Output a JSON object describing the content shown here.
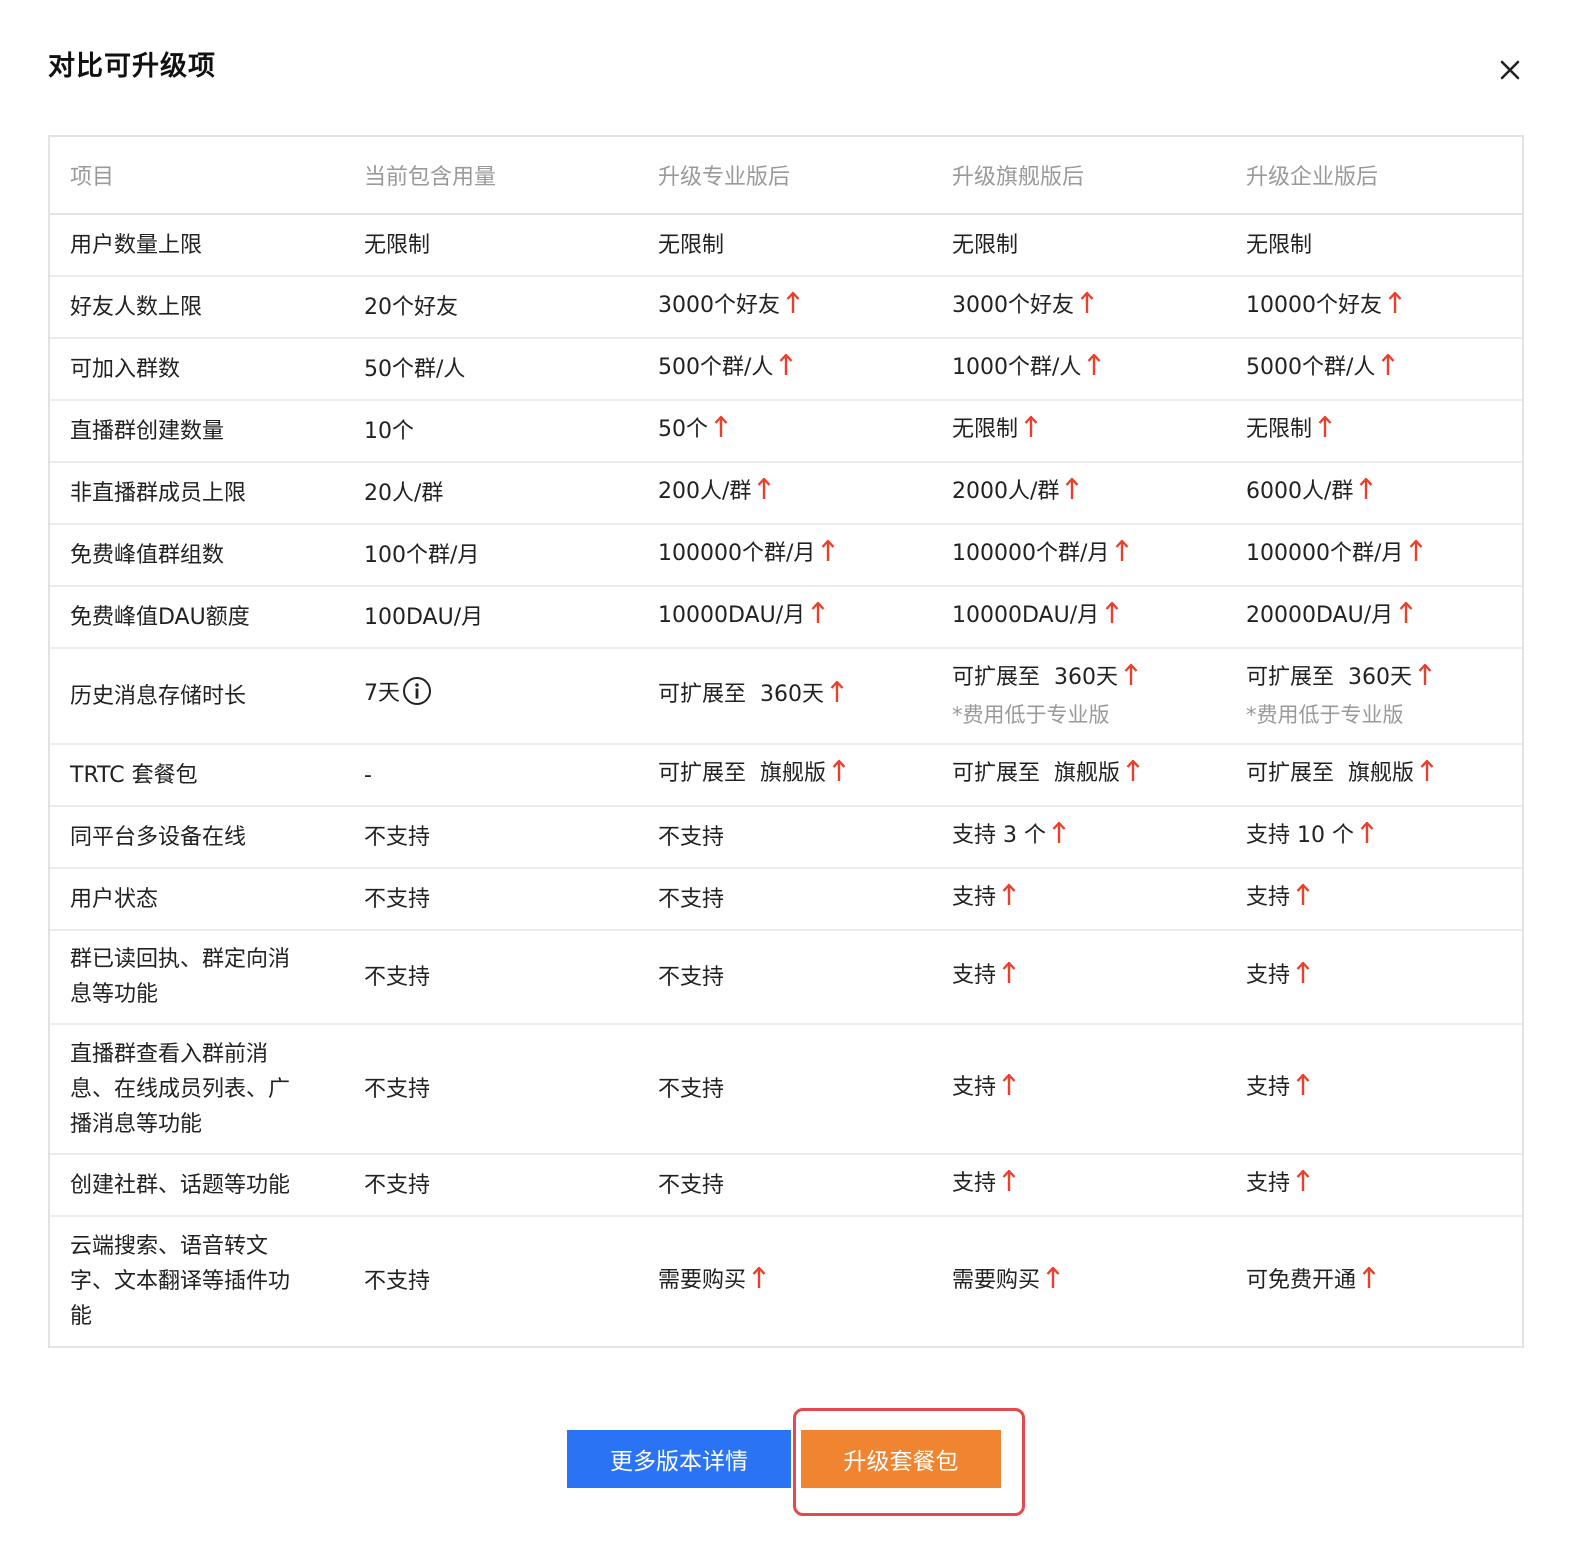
{
  "dialog": {
    "title": "对比可升级项",
    "close_icon": "close-icon"
  },
  "colors": {
    "accent_blue": "#2a73f4",
    "accent_orange": "#f08430",
    "arrow_red": "#e8402c",
    "highlight_red": "#e5484d"
  },
  "table": {
    "headers": [
      "项目",
      "当前包含用量",
      "升级专业版后",
      "升级旗舰版后",
      "升级企业版后"
    ],
    "rows": [
      {
        "item": "用户数量上限",
        "current": "无限制",
        "cells": [
          {
            "text": "无限制",
            "up": false
          },
          {
            "text": "无限制",
            "up": false
          },
          {
            "text": "无限制",
            "up": false
          }
        ]
      },
      {
        "item": "好友人数上限",
        "current": "20个好友",
        "cells": [
          {
            "text": "3000个好友",
            "up": true
          },
          {
            "text": "3000个好友",
            "up": true
          },
          {
            "text": "10000个好友",
            "up": true
          }
        ]
      },
      {
        "item": "可加入群数",
        "current": "50个群/人",
        "cells": [
          {
            "text": "500个群/人",
            "up": true
          },
          {
            "text": "1000个群/人",
            "up": true
          },
          {
            "text": "5000个群/人",
            "up": true
          }
        ]
      },
      {
        "item": "直播群创建数量",
        "current": "10个",
        "cells": [
          {
            "text": "50个",
            "up": true
          },
          {
            "text": "无限制",
            "up": true
          },
          {
            "text": "无限制",
            "up": true
          }
        ]
      },
      {
        "item": "非直播群成员上限",
        "current": "20人/群",
        "cells": [
          {
            "text": "200人/群",
            "up": true
          },
          {
            "text": "2000人/群",
            "up": true
          },
          {
            "text": "6000人/群",
            "up": true
          }
        ]
      },
      {
        "item": "免费峰值群组数",
        "current": "100个群/月",
        "cells": [
          {
            "text": "100000个群/月",
            "up": true
          },
          {
            "text": "100000个群/月",
            "up": true
          },
          {
            "text": "100000个群/月",
            "up": true
          }
        ]
      },
      {
        "item": "免费峰值DAU额度",
        "current": "100DAU/月",
        "cells": [
          {
            "text": "10000DAU/月",
            "up": true
          },
          {
            "text": "10000DAU/月",
            "up": true
          },
          {
            "text": "20000DAU/月",
            "up": true
          }
        ]
      },
      {
        "item": "历史消息存储时长",
        "current": "7天",
        "current_info_icon": "info-icon",
        "cells": [
          {
            "text": "可扩展至  360天",
            "up": true
          },
          {
            "text": "可扩展至  360天",
            "up": true,
            "note": "*费用低于专业版"
          },
          {
            "text": "可扩展至  360天",
            "up": true,
            "note": "*费用低于专业版"
          }
        ]
      },
      {
        "item": "TRTC 套餐包",
        "current": "-",
        "cells": [
          {
            "text": "可扩展至  旗舰版",
            "up": true
          },
          {
            "text": "可扩展至  旗舰版",
            "up": true
          },
          {
            "text": "可扩展至  旗舰版",
            "up": true
          }
        ]
      },
      {
        "item": "同平台多设备在线",
        "current": "不支持",
        "cells": [
          {
            "text": "不支持",
            "up": false
          },
          {
            "text": "支持 3 个",
            "up": true
          },
          {
            "text": "支持 10 个",
            "up": true
          }
        ]
      },
      {
        "item": "用户状态",
        "current": "不支持",
        "cells": [
          {
            "text": "不支持",
            "up": false
          },
          {
            "text": "支持",
            "up": true
          },
          {
            "text": "支持",
            "up": true
          }
        ]
      },
      {
        "item": "群已读回执、群定向消息等功能",
        "current": "不支持",
        "cells": [
          {
            "text": "不支持",
            "up": false
          },
          {
            "text": "支持",
            "up": true
          },
          {
            "text": "支持",
            "up": true
          }
        ]
      },
      {
        "item": "直播群查看入群前消息、在线成员列表、广播消息等功能",
        "current": "不支持",
        "cells": [
          {
            "text": "不支持",
            "up": false
          },
          {
            "text": "支持",
            "up": true
          },
          {
            "text": "支持",
            "up": true
          }
        ]
      },
      {
        "item": "创建社群、话题等功能",
        "current": "不支持",
        "cells": [
          {
            "text": "不支持",
            "up": false
          },
          {
            "text": "支持",
            "up": true
          },
          {
            "text": "支持",
            "up": true
          }
        ]
      },
      {
        "item": "云端搜索、语音转文字、文本翻译等插件功能",
        "current": "不支持",
        "cells": [
          {
            "text": "需要购买",
            "up": true
          },
          {
            "text": "需要购买",
            "up": true
          },
          {
            "text": "可免费开通",
            "up": true
          }
        ]
      }
    ]
  },
  "footer": {
    "detail_button": "更多版本详情",
    "upgrade_button": "升级套餐包"
  }
}
